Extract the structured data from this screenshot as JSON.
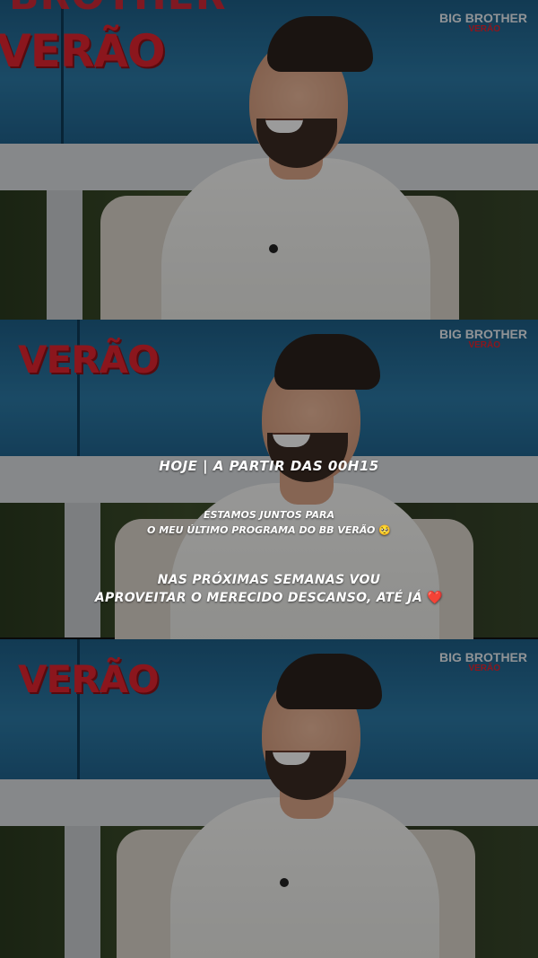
{
  "backdrop": {
    "show_top_text": "BROTHER",
    "show_title": "VERÃO",
    "logo_line1": "BIG BROTHER",
    "logo_line2": "VERÃO"
  },
  "captions": {
    "headline": "HOJE | A PARTIR DAS 00H15",
    "line2a": "ESTAMOS JUNTOS PARA",
    "line2b": "O MEU ÚLTIMO PROGRAMA DO BB VERÃO",
    "line2_emoji": "🥺",
    "line3a": "NAS PRÓXIMAS SEMANAS VOU",
    "line3b": "APROVEITAR O MERECIDO DESCANSO, ATÉ JÁ",
    "line3_emoji": "❤️"
  },
  "colors": {
    "brand_red": "#e0242f",
    "screen_blue": "#2b78a4",
    "caption_white": "#ffffff"
  }
}
